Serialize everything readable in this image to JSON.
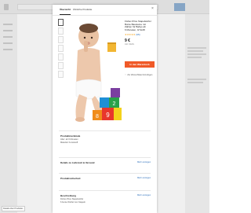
{
  "modal": {
    "tabs": [
      "Übersicht",
      "Ähnliche Produkte"
    ],
    "close_glyph": "×",
    "product": {
      "title_lines": [
        "Fisher-Price Stapelwürfel",
        "Bunte Bausteine mit",
        "Zahlen für Babys ab",
        "6 Monaten, GYH28"
      ],
      "rating_stars": "★★★★★",
      "rating_count": "(95)",
      "price": "9 €",
      "price_note": "inkl. MwSt.",
      "add_to_cart": "In den Warenkorb",
      "wishlist": "Zur Wunschliste hinzufügen",
      "wishlist_icon": "heart-icon"
    },
    "sections": [
      {
        "title": "Produktmerkmale",
        "lines": [
          "Alter: ab 6 Monaten",
          "Material: Kunststoff"
        ],
        "link": ""
      },
      {
        "title": "Details zu Lieferzeit & Versand",
        "lines": [],
        "link": "Mehr anzeigen"
      },
      {
        "title": "Produktsicherheit",
        "lines": [],
        "link": "Mehr anzeigen"
      },
      {
        "title": "Beschreibung",
        "lines": [
          "Fisher-Price Stapelwürfel",
          "6 bunte Würfel zum Stapeln"
        ],
        "link": "Mehr anzeigen"
      }
    ]
  },
  "bottom_note": "Details über Produkte…",
  "colors": {
    "accent": "#f05a28",
    "link": "#2a6ebb"
  }
}
